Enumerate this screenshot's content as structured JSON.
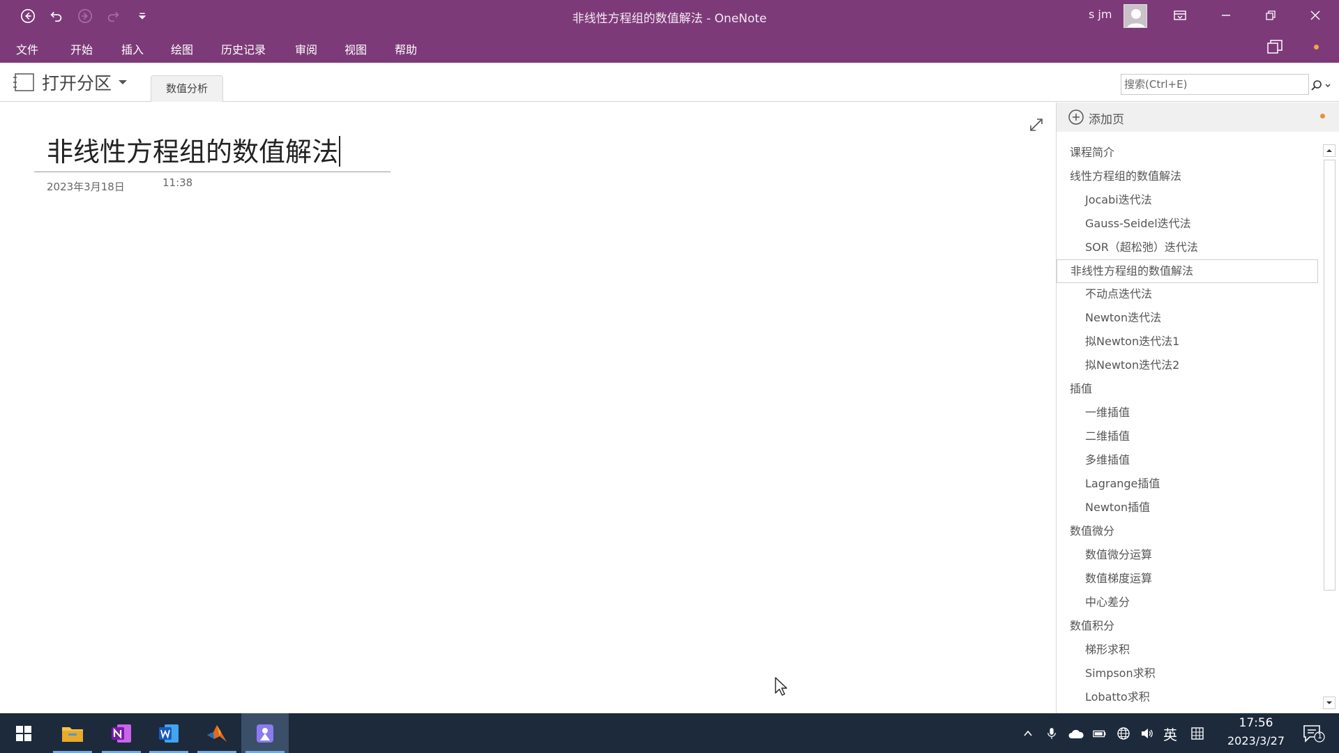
{
  "window": {
    "title": "非线性方程组的数值解法  -  OneNote",
    "user_name": "s jm",
    "accent_color": "#7d3a79"
  },
  "menu": [
    "文件",
    "开始",
    "插入",
    "绘图",
    "历史记录",
    "审阅",
    "视图",
    "帮助"
  ],
  "section_bar": {
    "open_section_label": "打开分区",
    "active_section_tab": "数值分析",
    "search_placeholder": "搜索(Ctrl+E)"
  },
  "page": {
    "title": "非线性方程组的数值解法",
    "date": "2023年3月18日",
    "time": "11:38"
  },
  "page_panel": {
    "add_page_label": "添加页",
    "pages": [
      {
        "label": "课程简介",
        "level": 0
      },
      {
        "label": "线性方程组的数值解法",
        "level": 0
      },
      {
        "label": "Jocabi迭代法",
        "level": 1
      },
      {
        "label": "Gauss-Seidel迭代法",
        "level": 1
      },
      {
        "label": "SOR（超松弛）迭代法",
        "level": 1
      },
      {
        "label": "非线性方程组的数值解法",
        "level": 0,
        "selected": true
      },
      {
        "label": "不动点迭代法",
        "level": 1
      },
      {
        "label": "Newton迭代法",
        "level": 1
      },
      {
        "label": "拟Newton迭代法1",
        "level": 1
      },
      {
        "label": "拟Newton迭代法2",
        "level": 1
      },
      {
        "label": "插值",
        "level": 0
      },
      {
        "label": "一维插值",
        "level": 1
      },
      {
        "label": "二维插值",
        "level": 1
      },
      {
        "label": "多维插值",
        "level": 1
      },
      {
        "label": "Lagrange插值",
        "level": 1
      },
      {
        "label": "Newton插值",
        "level": 1
      },
      {
        "label": "数值微分",
        "level": 0
      },
      {
        "label": "数值微分运算",
        "level": 1
      },
      {
        "label": "数值梯度运算",
        "level": 1
      },
      {
        "label": "中心差分",
        "level": 1
      },
      {
        "label": "数值积分",
        "level": 0
      },
      {
        "label": "梯形求积",
        "level": 1
      },
      {
        "label": "Simpson求积",
        "level": 1
      },
      {
        "label": "Lobatto求积",
        "level": 1
      }
    ]
  },
  "taskbar": {
    "tray_ime_label": "英",
    "clock_time": "17:56",
    "clock_date": "2023/3/27",
    "notification_count": "1"
  }
}
